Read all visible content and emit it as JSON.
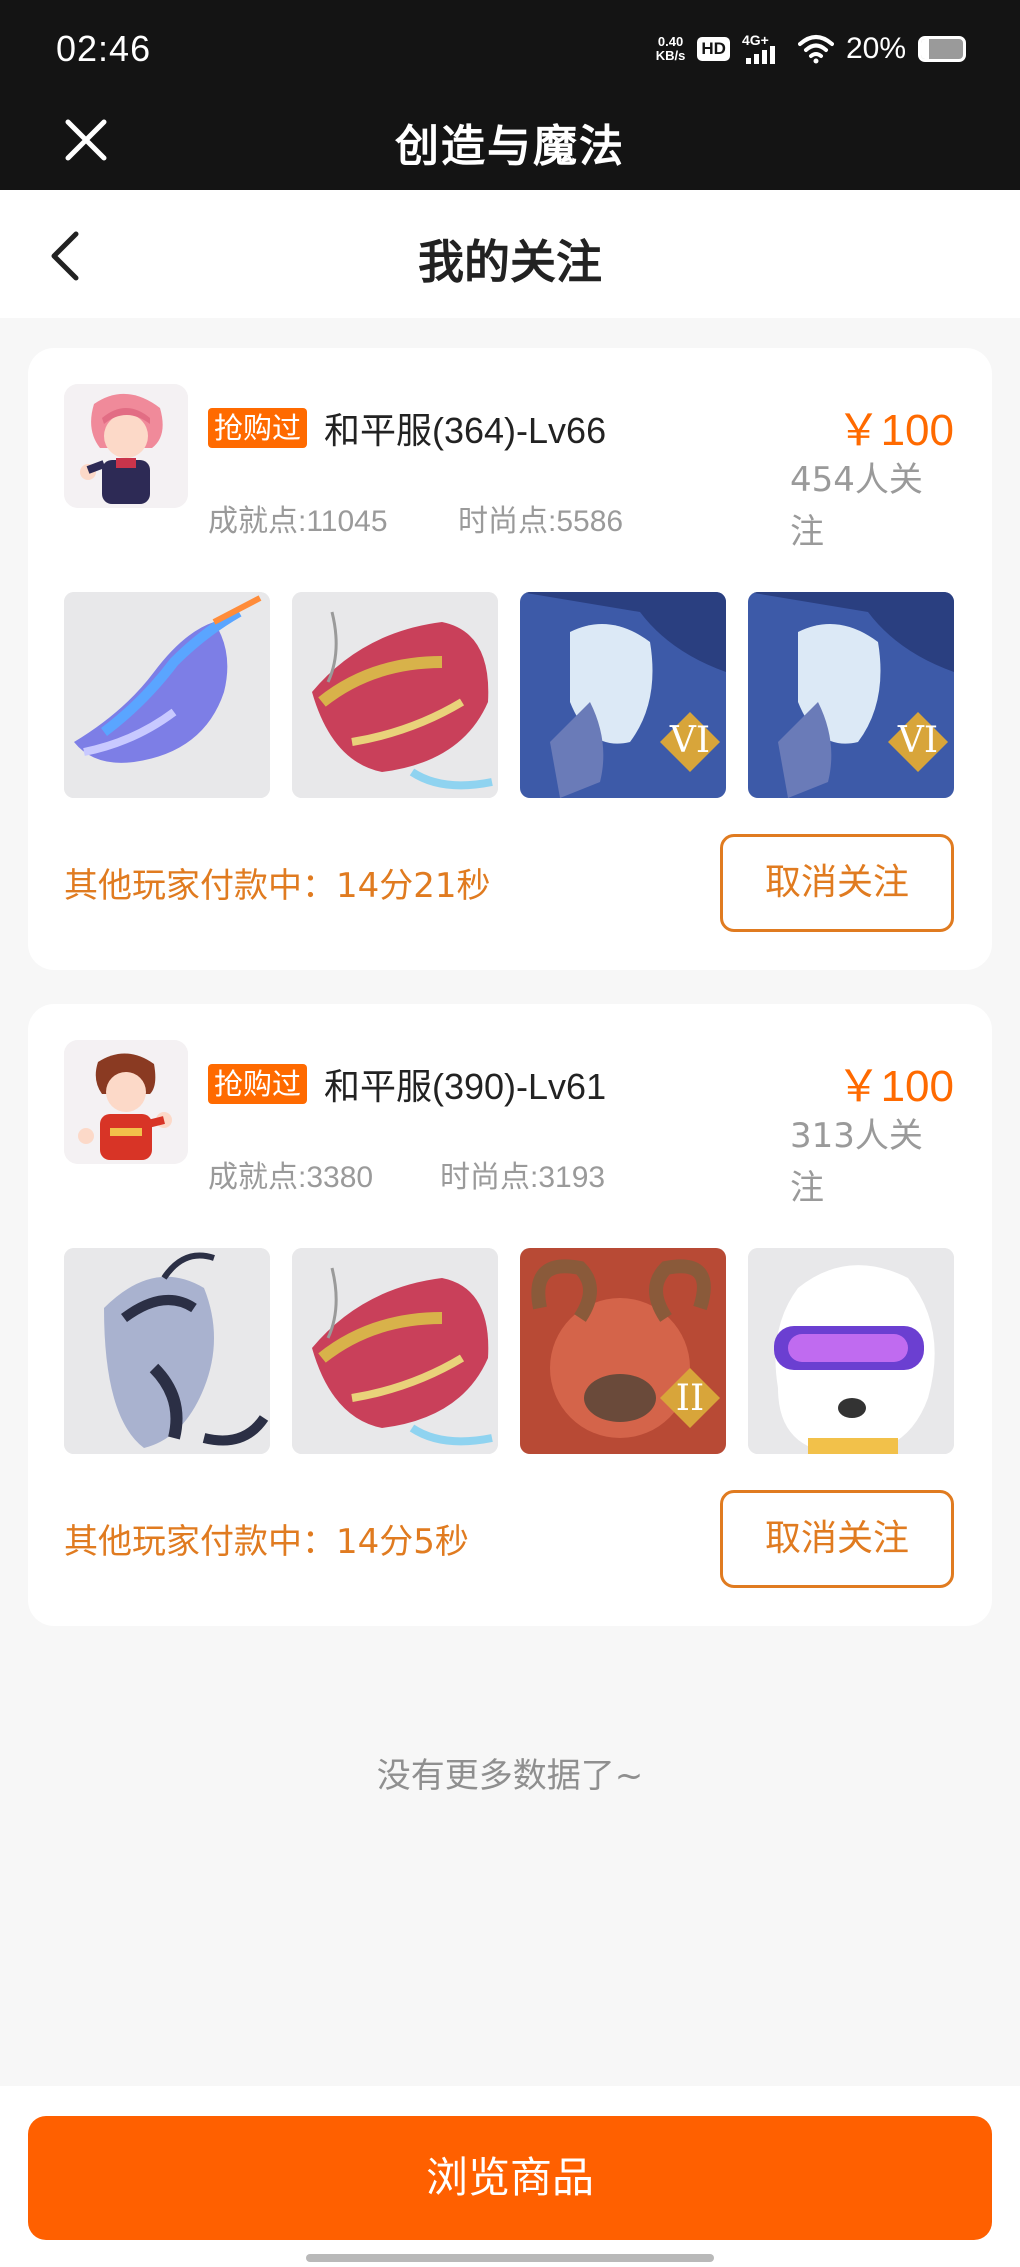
{
  "status_bar": {
    "time": "02:46",
    "net_speed_value": "0.40",
    "net_speed_unit": "KB/s",
    "hd_badge": "HD",
    "network_type": "4G+",
    "battery_percent_label": "20%",
    "battery_level": 0.2
  },
  "app_bar": {
    "title": "创造与魔法",
    "close_icon": "close-icon"
  },
  "page_header": {
    "title": "我的关注",
    "back_icon": "chevron-left-icon"
  },
  "colors": {
    "accent": "#ff6000",
    "accent_text": "#e07b20",
    "dark_bar": "#141414"
  },
  "listings": [
    {
      "tag": "抢购过",
      "name": "和平服(364)-Lv66",
      "achievement": "成就点:11045",
      "fashion": "时尚点:5586",
      "price": "￥100",
      "followers": "454人关注",
      "payment_status": "其他玩家付款中：14分21秒",
      "cancel_label": "取消关注",
      "thumbs": [
        "blue-dragon-mount",
        "red-gold-dragon-mount",
        "ice-wing-mount-VI",
        "ice-wing-mount-VI"
      ]
    },
    {
      "tag": "抢购过",
      "name": "和平服(390)-Lv61",
      "achievement": "成就点:3380",
      "fashion": "时尚点:3193",
      "price": "￥100",
      "followers": "313人关注",
      "payment_status": "其他玩家付款中：14分5秒",
      "cancel_label": "取消关注",
      "thumbs": [
        "silver-dragon-mount",
        "red-gold-dragon-mount",
        "red-ram-mount-II",
        "white-bear-goggles-pet"
      ]
    }
  ],
  "list_end_text": "没有更多数据了~",
  "browse_button": "浏览商品"
}
